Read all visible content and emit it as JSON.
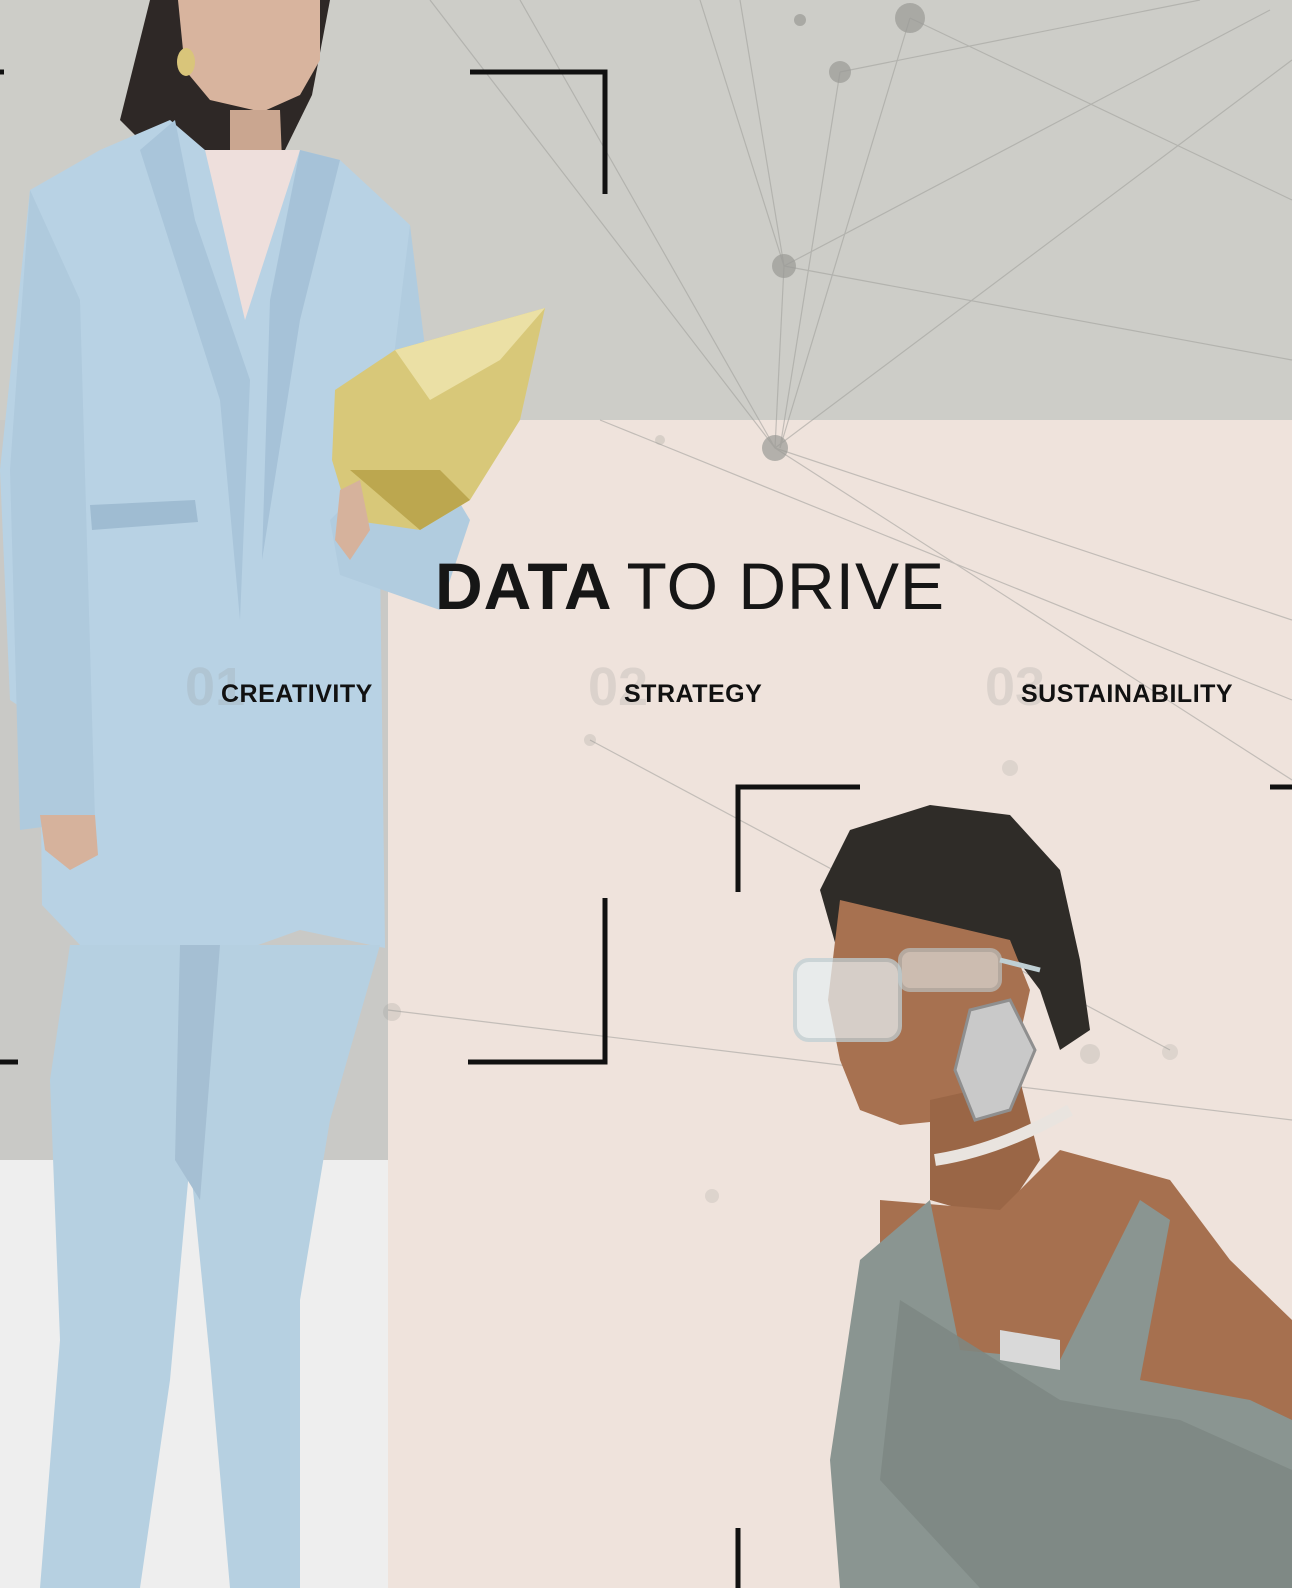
{
  "headline": {
    "strong": "DATA",
    "light": "TO DRIVE"
  },
  "pillars": [
    {
      "number": "01",
      "label": "CREATIVITY"
    },
    {
      "number": "02",
      "label": "STRATEGY"
    },
    {
      "number": "03",
      "label": "SUSTAINABILITY"
    }
  ],
  "colors": {
    "background_gray": "#cdcdc8",
    "background_pink": "#efe3dc",
    "suit_blue": "#b8d2e4",
    "dress_gray": "#8a9591",
    "bag_gold": "#d8c879",
    "text": "#161616"
  }
}
